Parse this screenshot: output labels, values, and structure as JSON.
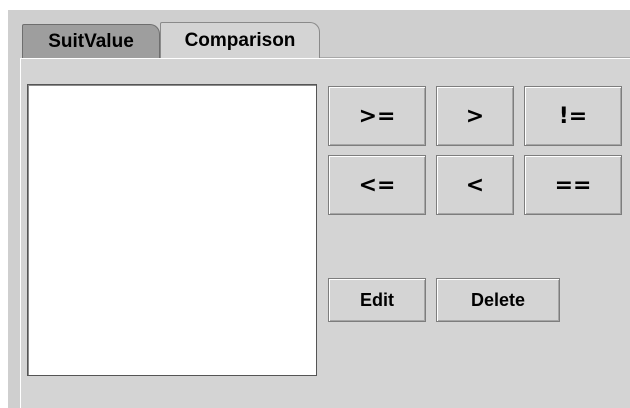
{
  "tabs": [
    {
      "label": "SuitValue",
      "selected": false
    },
    {
      "label": "Comparison",
      "selected": true
    }
  ],
  "operators": {
    "ge": ">=",
    "gt": ">",
    "ne": "!=",
    "le": "<=",
    "lt": "<",
    "eq": "=="
  },
  "actions": {
    "edit": "Edit",
    "delete": "Delete"
  },
  "colors": {
    "panel": "#d4d4d4",
    "inactive_tab": "#9e9e9e",
    "list_background": "#ffffff"
  }
}
